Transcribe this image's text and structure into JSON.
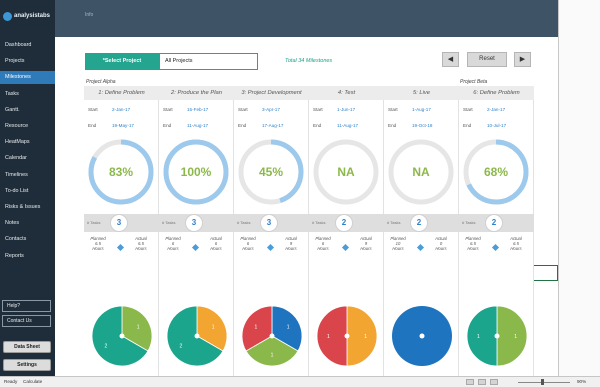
{
  "app": {
    "logo_text": "analysistabs"
  },
  "header": {
    "info": "Info"
  },
  "sidebar": {
    "items": [
      {
        "label": "Dashboard"
      },
      {
        "label": "Projects"
      },
      {
        "label": "Milestones"
      },
      {
        "label": "Tasks"
      },
      {
        "label": "Gantt."
      },
      {
        "label": "Resource"
      },
      {
        "label": "HeatMaps"
      },
      {
        "label": "Calendar"
      },
      {
        "label": "Timelines"
      },
      {
        "label": "To-do List"
      },
      {
        "label": "Risks & Issues"
      },
      {
        "label": "Notes"
      },
      {
        "label": "Contacts"
      },
      {
        "label": "Reports"
      }
    ],
    "active_index": 2,
    "help": "Help?",
    "contact_us": "Contact Us",
    "data_sheet": "Data Sheet",
    "settings": "Settings"
  },
  "controls": {
    "select_project": "*Select Project",
    "project_value": "All Projects",
    "total_milestones": "Total 34 Milestones",
    "prev": "◀",
    "reset": "Reset",
    "next": "▶"
  },
  "project_labels": {
    "left": "Project Alpha",
    "right": "Project Beta"
  },
  "labels": {
    "start": "Start",
    "end": "End",
    "tasks": "# Tasks",
    "planned": "Planned",
    "actual": "Actual",
    "hours": "Hours"
  },
  "colors": {
    "teal": "#23a590",
    "ring_blue": "#9cc9ec",
    "ring_track": "#e6e6e6",
    "pct_green": "#8cb84a",
    "pie_teal": "#1aa58c",
    "pie_green": "#8ab84a",
    "pie_orange": "#f2a531",
    "pie_red": "#d9454a",
    "pie_blue": "#1f74bf"
  },
  "milestones": [
    {
      "title": "1: Define Problem",
      "start": "2-Jan-17",
      "end": "19-May-17",
      "progress_label": "83%",
      "progress": 0.83,
      "tasks": "3",
      "planned": "6.5",
      "actual": "6.5",
      "pie": [
        {
          "value": 1,
          "color": "#8ab84a"
        },
        {
          "value": 2,
          "color": "#1aa58c"
        }
      ]
    },
    {
      "title": "2: Produce the Plan",
      "start": "15-Feb-17",
      "end": "11-Aug-17",
      "progress_label": "100%",
      "progress": 1.0,
      "tasks": "3",
      "planned": "6",
      "actual": "6",
      "pie": [
        {
          "value": 1,
          "color": "#f2a531"
        },
        {
          "value": 2,
          "color": "#1aa58c"
        }
      ]
    },
    {
      "title": "3: Project Development",
      "start": "3-Apr-17",
      "end": "17-Aug-17",
      "progress_label": "45%",
      "progress": 0.45,
      "tasks": "3",
      "planned": "6",
      "actual": "9",
      "pie": [
        {
          "value": 1,
          "color": "#1f74bf"
        },
        {
          "value": 1,
          "color": "#8ab84a"
        },
        {
          "value": 1,
          "color": "#d9454a"
        }
      ]
    },
    {
      "title": "4: Test",
      "start": "1-Jun-17",
      "end": "11-Aug-17",
      "progress_label": "NA",
      "progress": null,
      "tasks": "2",
      "planned": "6",
      "actual": "9",
      "pie": [
        {
          "value": 1,
          "color": "#f2a531"
        },
        {
          "value": 1,
          "color": "#d9454a"
        }
      ]
    },
    {
      "title": "5: Live",
      "start": "1-Aug-17",
      "end": "19-Oct-18",
      "progress_label": "NA",
      "progress": null,
      "tasks": "2",
      "planned": "10",
      "actual": "0",
      "pie": [
        {
          "value": 1,
          "color": "#1f74bf"
        }
      ]
    },
    {
      "title": "6: Define Problem",
      "start": "2-Jan-17",
      "end": "10-Jul-17",
      "progress_label": "68%",
      "progress": 0.68,
      "tasks": "2",
      "planned": "6.5",
      "actual": "6.5",
      "pie": [
        {
          "value": 1,
          "color": "#8ab84a"
        },
        {
          "value": 1,
          "color": "#1aa58c"
        }
      ]
    }
  ],
  "statusbar": {
    "ready": "Ready",
    "calculate": "Calculate",
    "zoom": "90%"
  }
}
